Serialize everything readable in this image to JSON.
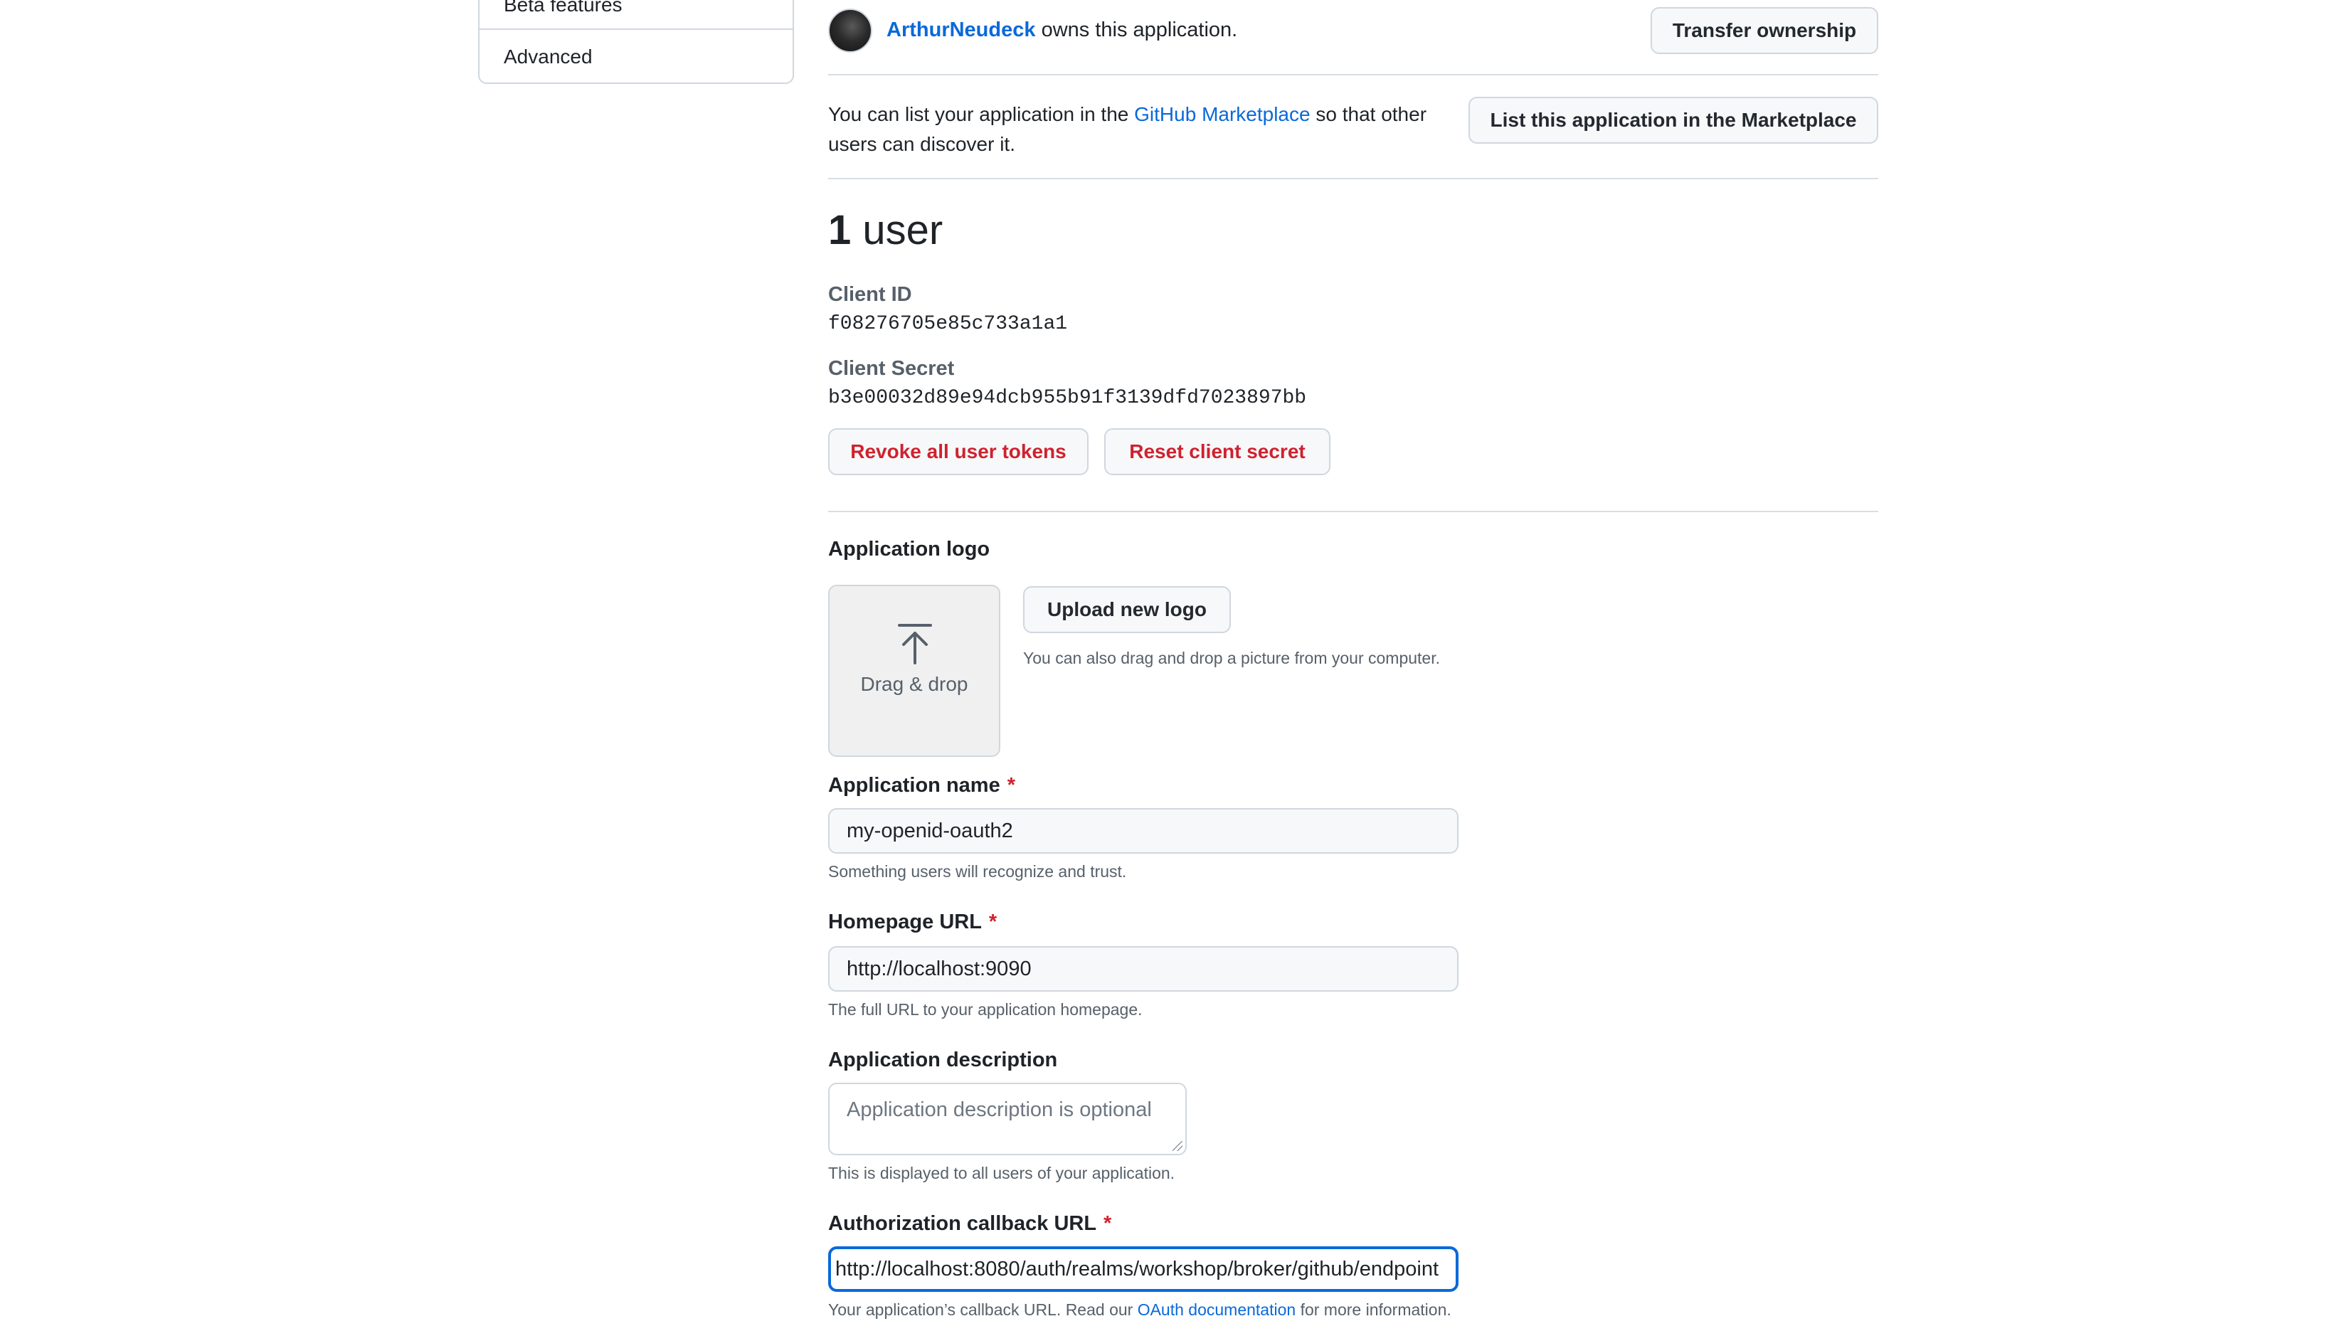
{
  "sidebar": {
    "items": [
      {
        "label": "Beta features"
      },
      {
        "label": "Advanced"
      }
    ]
  },
  "owner": {
    "username": "ArthurNeudeck",
    "suffix": "owns this application.",
    "transfer_label": "Transfer ownership"
  },
  "marketplace": {
    "text_before": "You can list your application in the",
    "link": "GitHub Marketplace",
    "text_after": "so that other users can discover it.",
    "button_label": "List this application in the Marketplace"
  },
  "users": {
    "count": "1",
    "label": "user"
  },
  "credentials": {
    "client_id_label": "Client ID",
    "client_id": "f08276705e85c733a1a1",
    "client_secret_label": "Client Secret",
    "client_secret": "b3e00032d89e94dcb955b91f3139dfd7023897bb",
    "revoke_label": "Revoke all user tokens",
    "reset_label": "Reset client secret"
  },
  "logo": {
    "label": "Application logo",
    "drag_drop": "Drag & drop",
    "upload_label": "Upload new logo",
    "hint": "You can also drag and drop a picture from your computer."
  },
  "form": {
    "required_mark": "*",
    "app_name": {
      "label": "Application name",
      "value": "my-openid-oauth2",
      "hint": "Something users will recognize and trust."
    },
    "homepage": {
      "label": "Homepage URL",
      "value": "http://localhost:9090",
      "hint": "The full URL to your application homepage."
    },
    "description": {
      "label": "Application description",
      "placeholder": "Application description is optional",
      "hint": "This is displayed to all users of your application."
    },
    "callback": {
      "label": "Authorization callback URL",
      "value": "http://localhost:8080/auth/realms/workshop/broker/github/endpoint",
      "hint_before": "Your application’s callback URL. Read our",
      "hint_link": "OAuth documentation",
      "hint_after": "for more information."
    }
  },
  "colors": {
    "link": "#0969da",
    "danger": "#cf222e",
    "focus": "#0969da"
  },
  "icons": [
    "upload-icon"
  ]
}
